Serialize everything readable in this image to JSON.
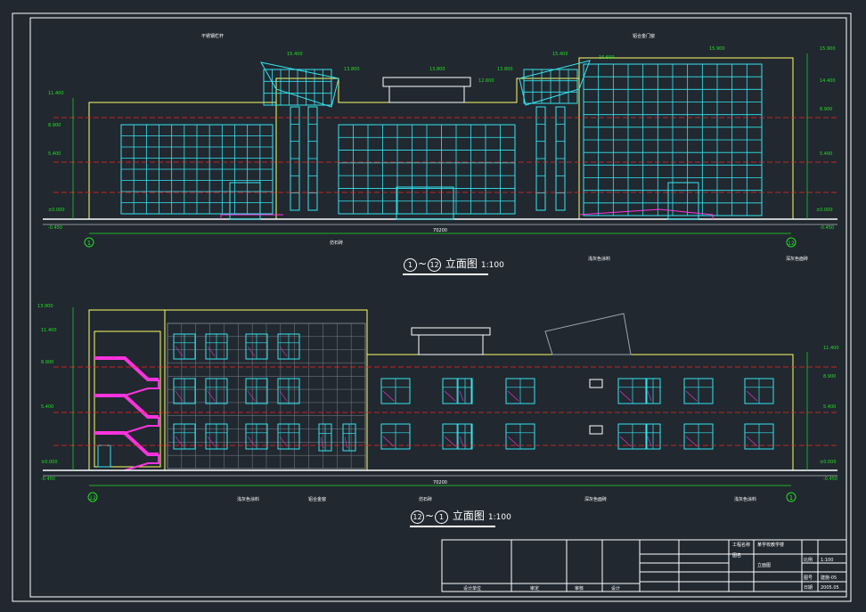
{
  "drawing": {
    "colors": {
      "background": "#212830",
      "frame": "#ffffff",
      "outline": "#ffff66",
      "curtain_wall": "#35e6f0",
      "dimension": "#22e022",
      "level_line": "#ff2222",
      "stair": "#ff33dd"
    },
    "front_elevation": {
      "caption_a": "1",
      "caption_mid": "~",
      "caption_b": "12",
      "title": "立面图",
      "scale": "1:100",
      "levels": [
        "11.400",
        "8.900",
        "5.400",
        "±0.000",
        "-0.450"
      ],
      "right_levels": [
        "15.900",
        "14.400",
        "8.900",
        "5.400",
        "±0.000",
        "-0.450"
      ],
      "roof_levels": [
        "15.400",
        "13.800",
        "13.800",
        "12.600",
        "13.800",
        "15.400",
        "16.600",
        "15.900"
      ],
      "axis_left": "1",
      "axis_right": "12",
      "total_dim": "70200",
      "notes": [
        "不锈钢栏杆",
        "铝合金门窗",
        "仿石砖",
        "浅灰色涂料",
        "深灰色面砖"
      ]
    },
    "rear_elevation": {
      "caption_a": "12",
      "caption_mid": "~",
      "caption_b": "1",
      "title": "立面图",
      "scale": "1:100",
      "levels": [
        "13.900",
        "11.400",
        "8.900",
        "5.400",
        "±0.000",
        "-0.450"
      ],
      "right_levels": [
        "11.400",
        "8.900",
        "5.400",
        "±0.000",
        "-0.450"
      ],
      "axis_left": "12",
      "axis_right": "1",
      "total_dim": "70200",
      "notes": [
        "浅灰色涂料",
        "铝合金窗",
        "仿石砖",
        "深灰色面砖",
        "浅灰色涂料"
      ]
    },
    "title_block": {
      "project_label": "工程名称",
      "project_name": "某学校教学楼",
      "drawing_label": "图名",
      "drawing_name": "立面图",
      "scale_label": "比例",
      "scale_value": "1:100",
      "sheet_label": "图号",
      "sheet_value": "建施-05",
      "date_label": "日期",
      "date_value": "2005.05",
      "footer_cells": [
        "设计单位",
        "审定",
        "审核",
        "设计"
      ]
    }
  }
}
